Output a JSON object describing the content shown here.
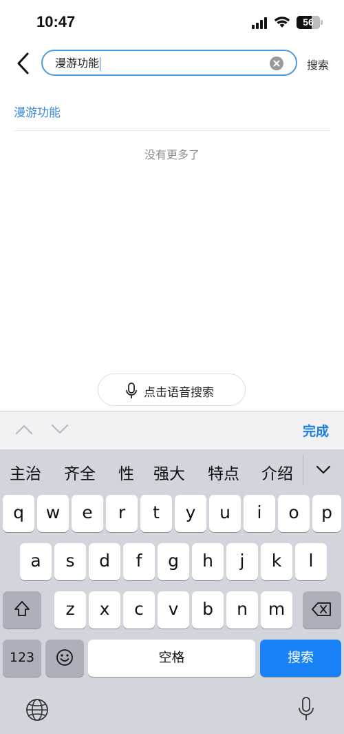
{
  "status_bar": {
    "time": "10:47",
    "battery": "56"
  },
  "header": {
    "search_value": "漫游功能",
    "search_button": "搜索"
  },
  "results": {
    "suggestions": [
      "漫游功能"
    ],
    "end_text": "没有更多了"
  },
  "voice_search": {
    "label": "点击语音搜索"
  },
  "accessory_bar": {
    "done_label": "完成"
  },
  "keyboard": {
    "candidates": [
      "主治",
      "齐全",
      "性",
      "强大",
      "特点",
      "介绍"
    ],
    "row1": [
      "q",
      "w",
      "e",
      "r",
      "t",
      "y",
      "u",
      "i",
      "o",
      "p"
    ],
    "row2": [
      "a",
      "s",
      "d",
      "f",
      "g",
      "h",
      "j",
      "k",
      "l"
    ],
    "row3": [
      "z",
      "x",
      "c",
      "v",
      "b",
      "n",
      "m"
    ],
    "numbers_key": "123",
    "space_key": "空格",
    "search_key": "搜索"
  },
  "colors": {
    "accent": "#1a82f7",
    "link": "#3b8ad6",
    "search_border": "#4a9be0"
  },
  "icons": [
    "back-icon",
    "clear-icon",
    "microphone-icon",
    "chevron-up-icon",
    "chevron-down-icon",
    "shift-icon",
    "backspace-icon",
    "emoji-icon",
    "globe-icon"
  ]
}
